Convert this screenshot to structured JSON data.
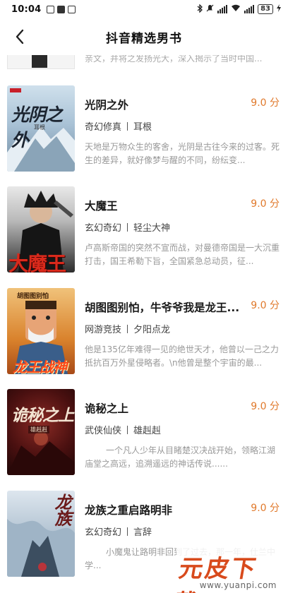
{
  "status_bar": {
    "time": "10:04",
    "battery": "83"
  },
  "header": {
    "title": "抖音精选男书"
  },
  "partial_item": {
    "description": "亲文，并将之发扬光大，深入揭示了当时中国..."
  },
  "books": [
    {
      "title": "光阴之外",
      "score": "9.0 分",
      "genre": "奇幻修真",
      "author": "耳根",
      "description": "天地是万物众生的客舍，光阴是古往今来的过客。死生的差异，就好像梦与醒的不同，纷纭变...",
      "cover_text": "光阴之外",
      "cover_author": "耳根"
    },
    {
      "title": "大魔王",
      "score": "9.0 分",
      "genre": "玄幻奇幻",
      "author": "轻尘大神",
      "description": "卢高斯帝国的突然不宣而战，对曼德帝国是一大沉重打击，国王希勒下旨，全国紧急总动员，征...",
      "cover_text": "大魔王"
    },
    {
      "title": "胡图图别怕，牛爷爷我是龙王...",
      "score": "9.0 分",
      "genre": "网游竞技",
      "author": "夕阳点龙",
      "description": "他是135亿年难得一见的绝世天才，他曾以一己之力抵抗百万外星侵略者。\\n他曾是整个宇宙的最...",
      "cover_text": "龙王战神",
      "cover_top_text": "胡图图别怕"
    },
    {
      "title": "诡秘之上",
      "score": "9.0 分",
      "genre": "武侠仙侠",
      "author": "雄赳赳",
      "description": "一个凡人少年从目睹楚汉决战开始，领略江湖庙堂之高远，追溯遥远的神话传说......",
      "cover_text": "诡秘之上",
      "cover_author": "雄赳赳"
    },
    {
      "title": "龙族之重启路明非",
      "score": "9.0 分",
      "genre": "玄幻奇幻",
      "author": "言辞",
      "description": "小魔鬼让路明非回到了过去，那一年，仕兰中学...",
      "cover_text": "龙族"
    }
  ],
  "watermark": {
    "text": "元皮下载",
    "url": "www.yuanpi.com"
  },
  "colors": {
    "score": "#e0792b",
    "accent": "#d84a1c"
  }
}
